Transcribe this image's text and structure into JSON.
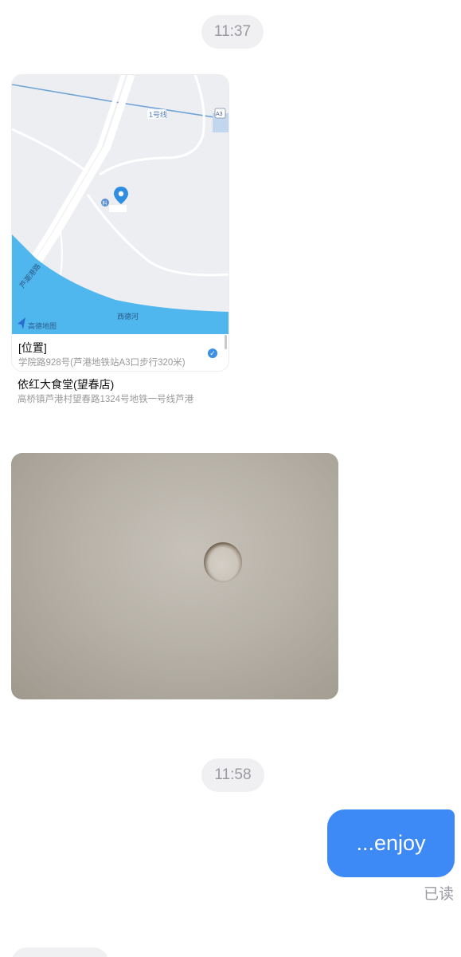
{
  "timestamps": [
    "11:37",
    "11:58"
  ],
  "location_card": {
    "map_watermark": "高德地图",
    "map_labels": {
      "metro_line": "1号线",
      "exit_marker": "A3",
      "river_name": "西德河",
      "road_label": "芦潮港路",
      "poi_marker": "料"
    },
    "title": "[位置]",
    "address": "学院路928号(芦港地铁站A3口步行320米)",
    "selected_icon": "check-circle-icon"
  },
  "place": {
    "name": "依红大食堂(望春店)",
    "address": "高桥镇芦港村望春路1324号地铁一号线芦港"
  },
  "outgoing_message": {
    "text": "...enjoy",
    "status": "已读"
  },
  "colors": {
    "bubble_out": "#3d8af7",
    "map_water": "#4fb6ee",
    "map_pin": "#2f8ee0",
    "map_land": "#eceef2"
  }
}
